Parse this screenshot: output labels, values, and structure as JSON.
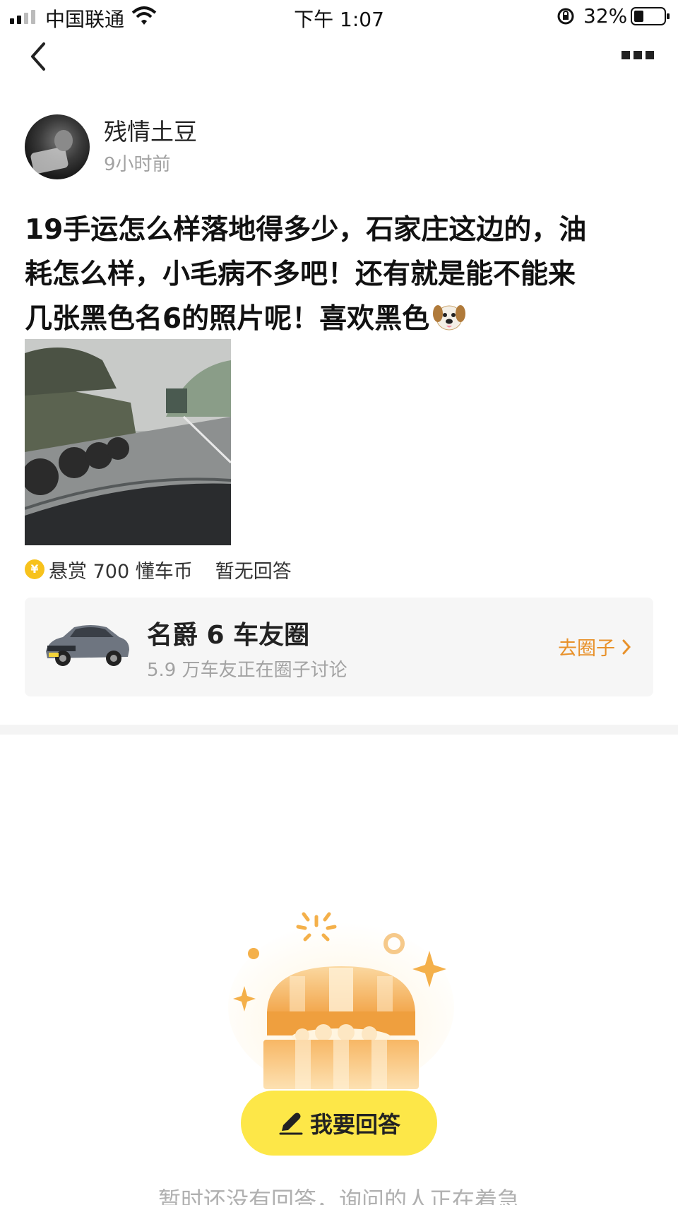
{
  "status_bar": {
    "carrier": "中国联通",
    "time": "下午 1:07",
    "battery_percent": "32%",
    "battery_level": 0.32
  },
  "nav": {
    "back_icon": "chevron-left-icon",
    "more_icon": "more-dots-icon"
  },
  "post": {
    "author": "残情土豆",
    "time_ago": "9小时前",
    "question_line1": "19手运怎么样落地得多少，石家庄这边的，油",
    "question_line2": "耗怎么样，小毛病不多吧！还有就是能不能来",
    "question_line3": "几张黑色名6的照片呢！喜欢黑色",
    "emoji": "dog-face-emoji",
    "reward_label": "悬赏 700 懂车币",
    "answer_status": "暂无回答"
  },
  "circle": {
    "title": "名爵 6 车友圈",
    "subtitle": "5.9 万车友正在圈子讨论",
    "action_label": "去圈子"
  },
  "empty_state": {
    "button_label": "我要回答",
    "hint": "暂时还没有回答，询问的人正在着急"
  },
  "colors": {
    "accent_orange": "#e8912a",
    "button_yellow": "#fde748",
    "secondary_text": "#a2a2a2"
  }
}
